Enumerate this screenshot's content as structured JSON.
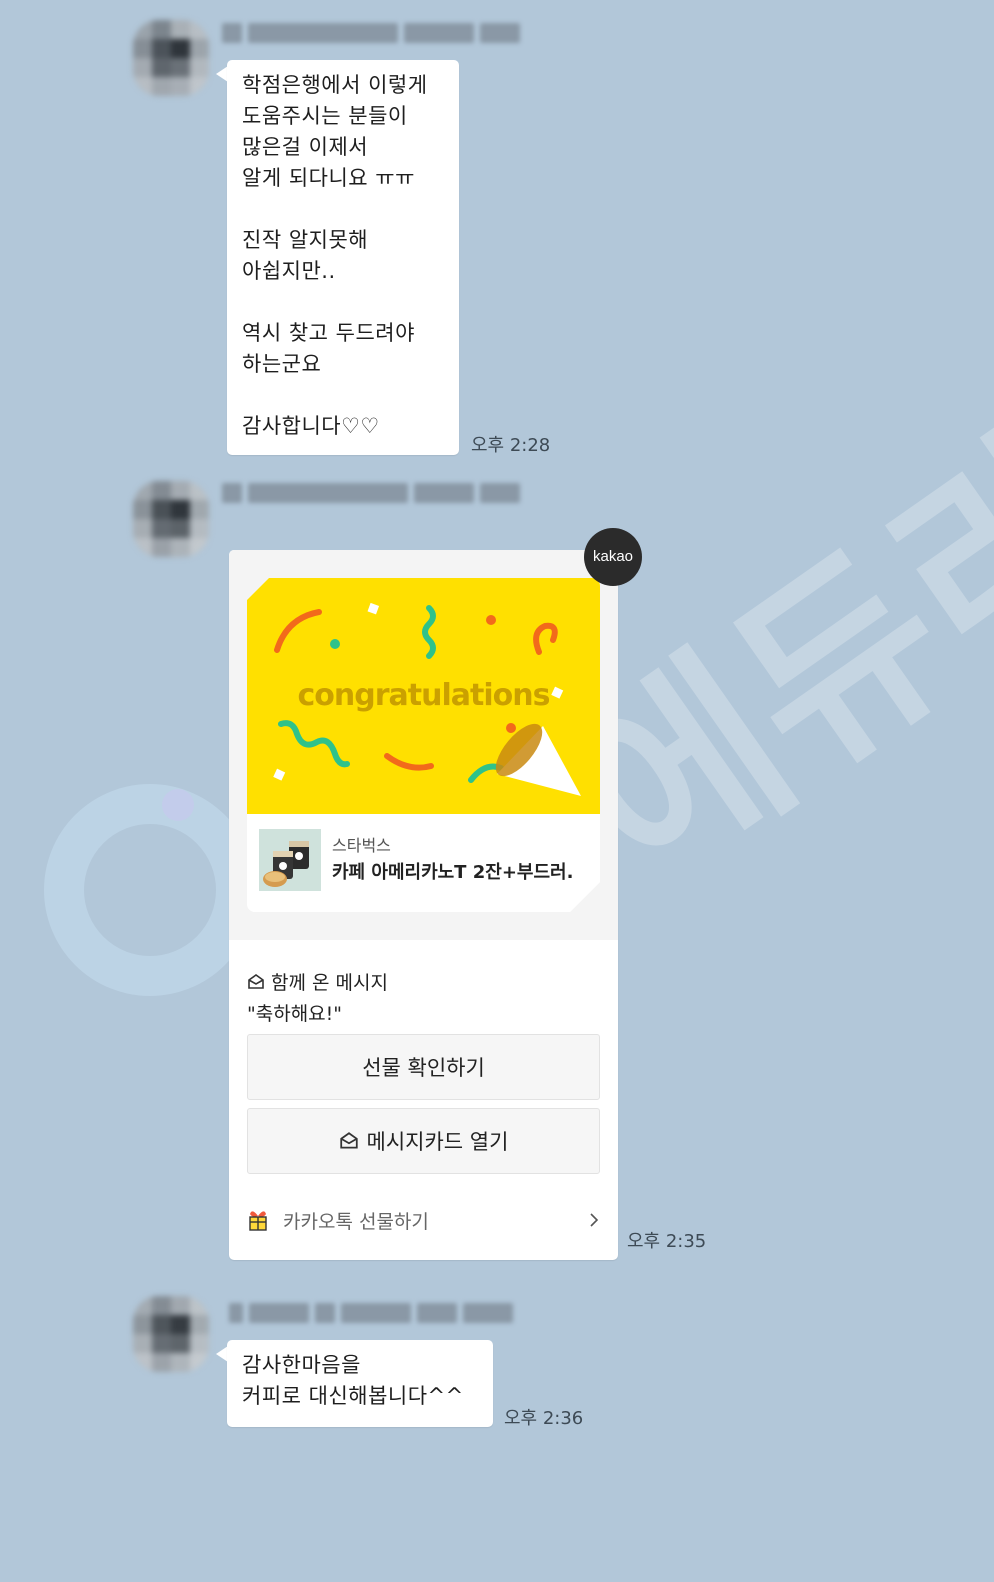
{
  "watermark": {
    "text": "에듀리온"
  },
  "messages": [
    {
      "text": "학점은행에서 이렇게\n도움주시는 분들이\n많은걸 이제서\n알게 되다니요 ㅠㅠ\n\n진작 알지못해\n아쉽지만..\n\n역시 찾고 두드려야\n하는군요\n\n감사합니다♡♡",
      "time": "오후 2:28"
    },
    {
      "text": "감사한마음을\n커피로 대신해봅니다^^",
      "time": "오후 2:36"
    }
  ],
  "gift": {
    "badge": "kakao",
    "banner_text": "congratulations",
    "brand": "스타벅스",
    "product": "카페 아메리카노T 2잔+부드러.",
    "message_label": "함께 온 메시지",
    "message_text": "\"축하해요!\"",
    "confirm_button": "선물 확인하기",
    "card_button": "메시지카드 열기",
    "footer": "카카오톡 선물하기",
    "time": "오후 2:35"
  },
  "colors": {
    "background": "#b2c7d9",
    "bubble": "#ffffff",
    "banner": "#ffe000"
  }
}
